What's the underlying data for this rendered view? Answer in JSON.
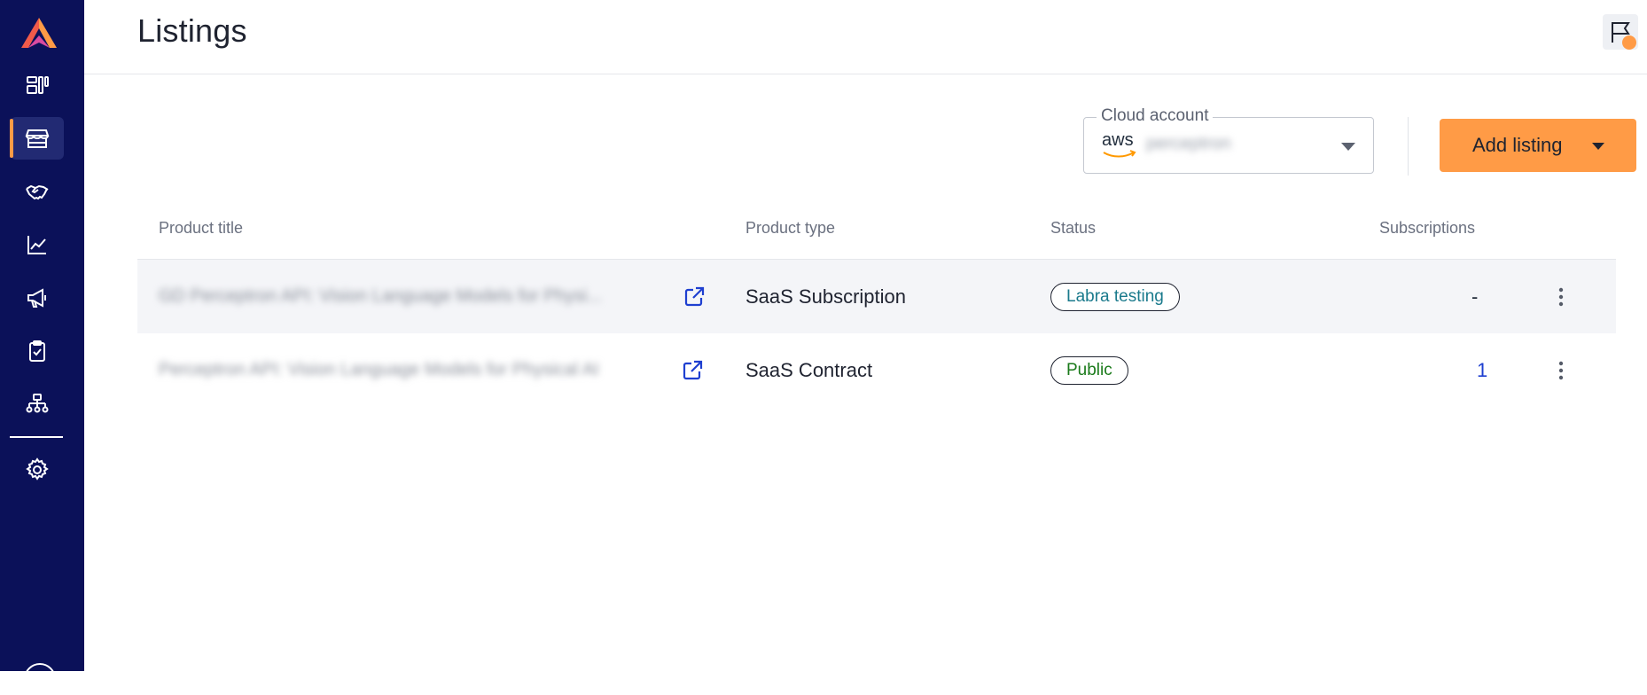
{
  "app": {
    "logo": "labra-logo"
  },
  "sidebar": {
    "items": [
      {
        "name": "dashboard",
        "icon": "dashboard-icon",
        "active": false
      },
      {
        "name": "listings",
        "icon": "storefront-icon",
        "active": true
      },
      {
        "name": "partners",
        "icon": "handshake-icon",
        "active": false
      },
      {
        "name": "analytics",
        "icon": "line-chart-icon",
        "active": false
      },
      {
        "name": "marketing",
        "icon": "megaphone-icon",
        "active": false
      },
      {
        "name": "tasks",
        "icon": "clipboard-check-icon",
        "active": false
      },
      {
        "name": "hierarchy",
        "icon": "org-chart-icon",
        "active": false
      },
      {
        "name": "settings",
        "icon": "gear-icon",
        "active": false
      }
    ],
    "accent_color": "#ff9b46",
    "background_color": "#0b1159"
  },
  "header": {
    "title": "Listings"
  },
  "cloud_account": {
    "label": "Cloud account",
    "provider_logo": "aws",
    "value": "perceptron"
  },
  "toolbar": {
    "add_listing_label": "Add listing",
    "add_listing_color": "#ff9b46"
  },
  "table": {
    "columns": [
      "Product title",
      "Product type",
      "Status",
      "Subscriptions"
    ],
    "rows": [
      {
        "title": "GD Perceptron API: Vision Language Models for Physi...",
        "type": "SaaS Subscription",
        "status": "Labra testing",
        "subscriptions": "-"
      },
      {
        "title": "Perceptron API: Vision Language Models for Physical AI",
        "type": "SaaS Contract",
        "status": "Public",
        "subscriptions": "1"
      }
    ]
  }
}
